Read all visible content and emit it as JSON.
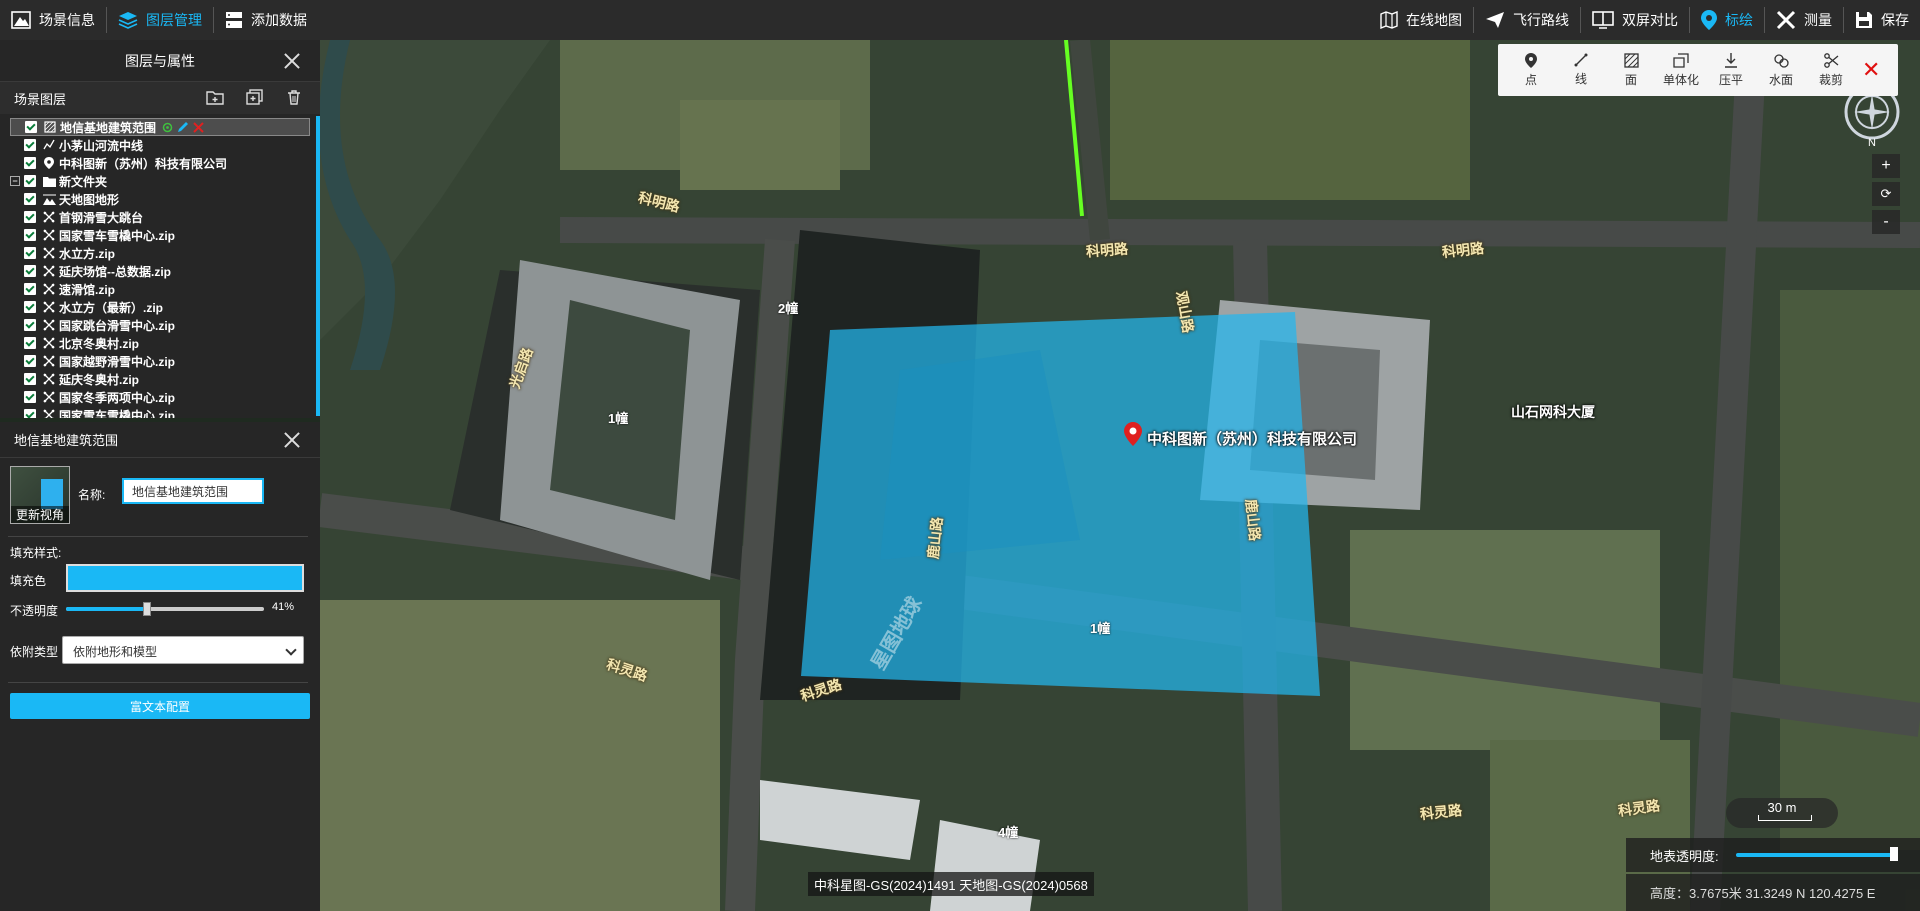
{
  "topbar": {
    "left": [
      {
        "label": "场景信息",
        "icon": "scene-info-icon"
      },
      {
        "label": "图层管理",
        "icon": "layers-icon",
        "active": true
      },
      {
        "label": "添加数据",
        "icon": "add-data-icon"
      }
    ],
    "right": [
      {
        "label": "在线地图",
        "icon": "online-map-icon"
      },
      {
        "label": "飞行路线",
        "icon": "flight-route-icon"
      },
      {
        "label": "双屏对比",
        "icon": "dual-screen-icon"
      },
      {
        "label": "标绘",
        "icon": "marker-icon",
        "active": true
      },
      {
        "label": "测量",
        "icon": "measure-icon"
      },
      {
        "label": "保存",
        "icon": "save-icon"
      }
    ]
  },
  "layer_panel": {
    "title": "图层与属性",
    "scene_layers_label": "场景图层",
    "layers": [
      {
        "name": "地信基地建筑范围",
        "icon": "polygon-icon",
        "selected": true,
        "level": 1
      },
      {
        "name": "小茅山河流中线",
        "icon": "polyline-icon",
        "level": 1
      },
      {
        "name": "中科图新（苏州）科技有限公司",
        "icon": "point-icon",
        "level": 1
      },
      {
        "name": "新文件夹",
        "icon": "folder-icon",
        "level": 0,
        "expander": "−"
      },
      {
        "name": "天地图地形",
        "icon": "terrain-icon",
        "level": 1
      },
      {
        "name": "首钢滑雪大跳台",
        "icon": "model-icon",
        "level": 1
      },
      {
        "name": "国家雪车雪橇中心.zip",
        "icon": "model-icon",
        "level": 1
      },
      {
        "name": "水立方.zip",
        "icon": "model-icon",
        "level": 1
      },
      {
        "name": "延庆场馆--总数据.zip",
        "icon": "model-icon",
        "level": 1
      },
      {
        "name": "速滑馆.zip",
        "icon": "model-icon",
        "level": 1
      },
      {
        "name": "水立方（最新）.zip",
        "icon": "model-icon",
        "level": 1
      },
      {
        "name": "国家跳台滑雪中心.zip",
        "icon": "model-icon",
        "level": 1
      },
      {
        "name": "北京冬奥村.zip",
        "icon": "model-icon",
        "level": 1
      },
      {
        "name": "国家越野滑雪中心.zip",
        "icon": "model-icon",
        "level": 1
      },
      {
        "name": "延庆冬奥村.zip",
        "icon": "model-icon",
        "level": 1
      },
      {
        "name": "国家冬季两项中心.zip",
        "icon": "model-icon",
        "level": 1
      },
      {
        "name": "国家雪车雪橇中心.zip",
        "icon": "model-icon",
        "level": 1
      }
    ]
  },
  "attr_panel": {
    "title": "地信基地建筑范围",
    "thumb_label": "更新视角",
    "name_label": "名称:",
    "name_value": "地信基地建筑范围",
    "fill_style_label": "填充样式:",
    "fill_color_label": "填充色",
    "fill_color": "#1ab8f5",
    "opacity_label": "不透明度",
    "opacity_value": 41,
    "opacity_text": "41%",
    "attach_label": "依附类型",
    "attach_value": "依附地形和模型",
    "rich_text_button": "富文本配置"
  },
  "draw_toolbar": [
    {
      "label": "点",
      "icon": "draw-point-icon"
    },
    {
      "label": "线",
      "icon": "draw-line-icon"
    },
    {
      "label": "面",
      "icon": "draw-polygon-icon"
    },
    {
      "label": "单体化",
      "icon": "monomer-icon"
    },
    {
      "label": "压平",
      "icon": "flatten-icon"
    },
    {
      "label": "水面",
      "icon": "water-icon"
    },
    {
      "label": "裁剪",
      "icon": "clip-icon"
    }
  ],
  "map": {
    "compass_label": "N",
    "zoom_in": "+",
    "reset": "⟳",
    "zoom_out": "-",
    "scale": "30 m",
    "road_labels": [
      "科明路",
      "科明路",
      "科明路",
      "科灵路",
      "科灵路",
      "科灵路",
      "科灵路",
      "光启路",
      "观山路",
      "鹿山路",
      "鹿山路"
    ],
    "poi": "中科图新（苏州）科技有限公司",
    "poi2": "山石网科大厦",
    "buildings": [
      "2幢",
      "1幢",
      "1幢",
      "4幢"
    ],
    "watermark": "星图地球",
    "copyright": "中科星图-GS(2024)1491 天地图-GS(2024)0568",
    "surface_opacity_label": "地表透明度:",
    "status": "高度：3.7675米 31.3249 N 120.4275 E"
  }
}
